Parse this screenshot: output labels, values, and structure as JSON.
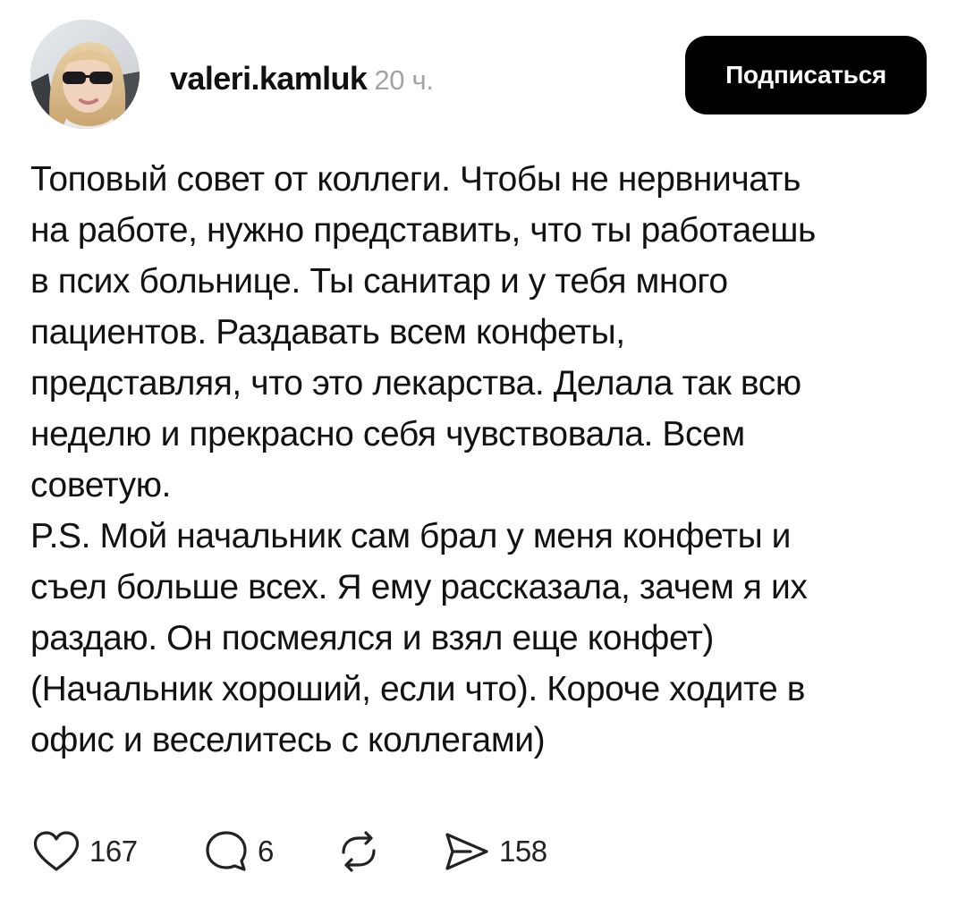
{
  "author": {
    "username": "valeri.kamluk",
    "time": "20 ч."
  },
  "follow_button": {
    "label": "Подписаться"
  },
  "post": {
    "lines": [
      "Топовый совет от коллеги. Чтобы не нервничать",
      "на работе, нужно представить, что ты работаешь",
      "в псих больнице. Ты санитар и у тебя много",
      "пациентов. Раздавать всем конфеты,",
      "представляя, что это лекарства. Делала так всю",
      "неделю и прекрасно себя чувствовала. Всем",
      "советую.",
      "P.S. Мой начальник сам брал у меня конфеты и",
      "съел больше всех. Я ему рассказала, зачем я их",
      "раздаю. Он посмеялся и взял еще конфет)",
      "(Начальник хороший, если что). Короче ходите в",
      "офис и веселитесь с коллегами)"
    ]
  },
  "actions": {
    "likes": "167",
    "comments": "6",
    "shares": "158",
    "icons": {
      "like": "heart-icon",
      "comment": "comment-bubble-icon",
      "repost": "repost-icon",
      "share": "send-icon"
    }
  },
  "colors": {
    "text": "#111111",
    "muted": "#a3a3a3",
    "button_bg": "#000000",
    "button_text": "#ffffff"
  }
}
